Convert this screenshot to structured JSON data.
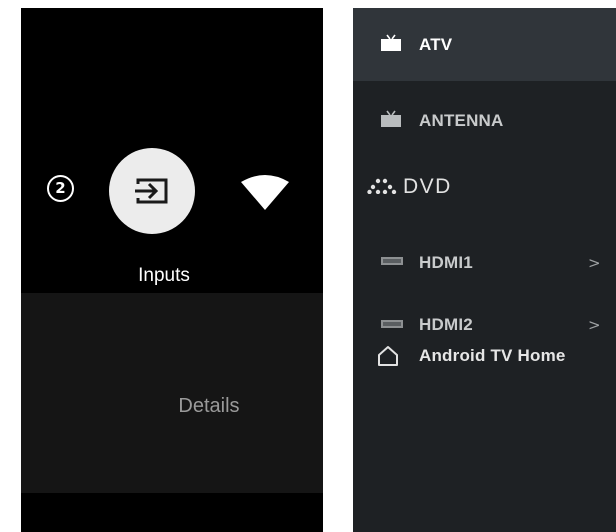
{
  "settings_row": {
    "badge_text": "2",
    "badge_icon": "numbered-circle-icon",
    "inputs_icon": "input-arrow-icon",
    "inputs_label": "Inputs",
    "wifi_icon": "wifi-signal-icon",
    "details_label": "Details"
  },
  "inputs_list": {
    "items": [
      {
        "label": "ATV",
        "icon": "tv-icon",
        "selected": true,
        "chevron": ""
      },
      {
        "label": "ANTENNA",
        "icon": "tv-icon",
        "selected": false,
        "chevron": ""
      },
      {
        "label": "DVD",
        "icon": "dvd-dots-icon",
        "selected": false,
        "chevron": ""
      },
      {
        "label": "HDMI1",
        "icon": "hdmi-port-icon",
        "selected": false,
        "chevron": ">"
      },
      {
        "label": "HDMI2",
        "icon": "hdmi-port-icon",
        "selected": false,
        "chevron": ">"
      },
      {
        "label": "Android TV Home",
        "icon": "home-icon",
        "selected": false,
        "chevron": ""
      }
    ]
  },
  "colors": {
    "left_background": "#000000",
    "details_background": "#151515",
    "list_background": "#1e2124",
    "selected_row": "#30353a",
    "inputs_circle": "#ececec"
  }
}
